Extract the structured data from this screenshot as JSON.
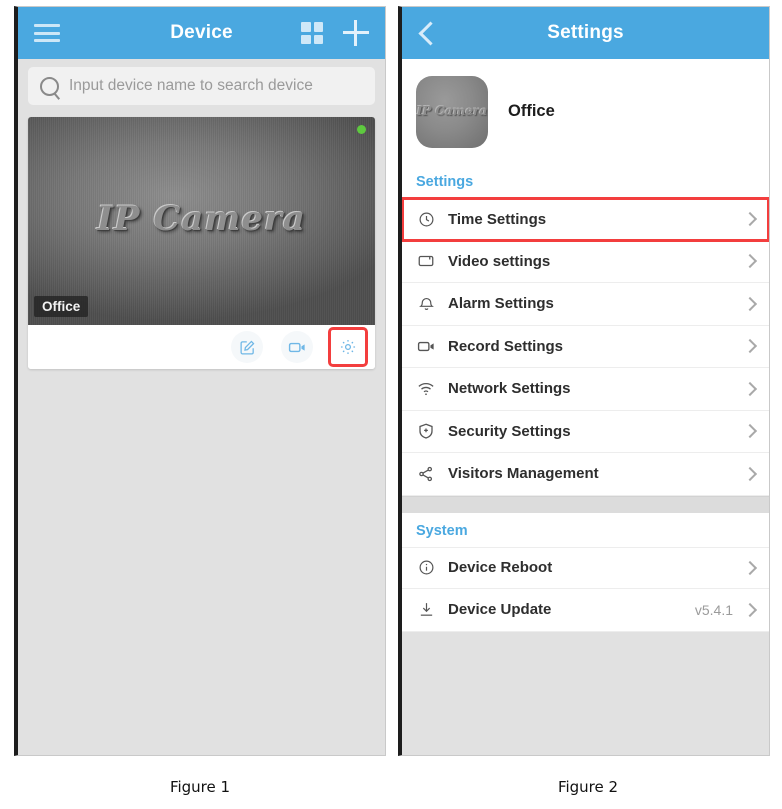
{
  "figure1": {
    "caption": "Figure 1",
    "topbar": {
      "title": "Device",
      "menu_icon": "hamburger-icon",
      "grid_icon": "grid-view-icon",
      "add_icon": "plus-icon"
    },
    "search": {
      "placeholder": "Input device name to search device",
      "icon": "search-icon"
    },
    "device_card": {
      "thumbnail_text": "IP Camera",
      "label": "Office",
      "status": "online",
      "status_color": "#5ec93f",
      "actions": [
        {
          "name": "edit-device-button",
          "icon": "edit-pencil-icon",
          "highlighted": false
        },
        {
          "name": "live-video-button",
          "icon": "video-camera-icon",
          "highlighted": false
        },
        {
          "name": "device-settings-button",
          "icon": "gear-icon",
          "highlighted": true
        }
      ]
    },
    "highlight_color": "#f33e3e",
    "accent_color": "#4aa8e0"
  },
  "figure2": {
    "caption": "Figure 2",
    "topbar": {
      "title": "Settings",
      "back_icon": "back-chevron-icon"
    },
    "device": {
      "avatar_text": "IP Camera",
      "name": "Office"
    },
    "settings_section": {
      "title": "Settings",
      "items": [
        {
          "label": "Time Settings",
          "icon": "clock-icon",
          "value": "",
          "highlighted": true
        },
        {
          "label": "Video settings",
          "icon": "monitor-icon",
          "value": "",
          "highlighted": false
        },
        {
          "label": "Alarm Settings",
          "icon": "bell-icon",
          "value": "",
          "highlighted": false
        },
        {
          "label": "Record Settings",
          "icon": "camcorder-icon",
          "value": "",
          "highlighted": false
        },
        {
          "label": "Network Settings",
          "icon": "wifi-icon",
          "value": "",
          "highlighted": false
        },
        {
          "label": "Security Settings",
          "icon": "shield-plus-icon",
          "value": "",
          "highlighted": false
        },
        {
          "label": "Visitors Management",
          "icon": "share-icon",
          "value": "",
          "highlighted": false
        }
      ]
    },
    "system_section": {
      "title": "System",
      "items": [
        {
          "label": "Device Reboot",
          "icon": "info-circle-icon",
          "value": ""
        },
        {
          "label": "Device Update",
          "icon": "download-arrow-icon",
          "value": "v5.4.1"
        }
      ]
    },
    "highlight_color": "#f33e3e",
    "accent_color": "#4aa8e0"
  }
}
